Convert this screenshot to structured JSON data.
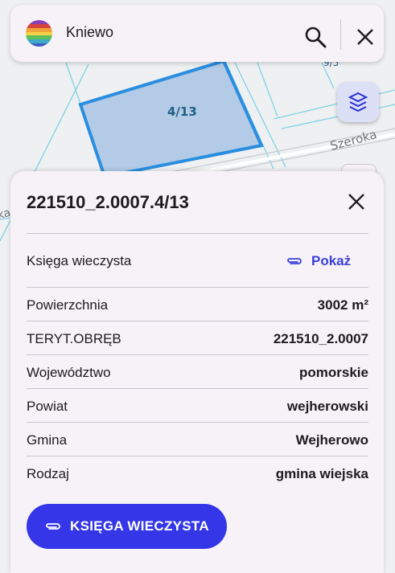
{
  "search": {
    "query": "Kniewo"
  },
  "map": {
    "road_label": "Szeroka",
    "parcel_label": "4/13",
    "partial_label_top": "9/5",
    "partial_label_left": "ka"
  },
  "sheet": {
    "title": "221510_2.0007.4/13",
    "kw_row": {
      "label": "Księga wieczysta",
      "link": "Pokaż"
    },
    "rows": [
      {
        "label": "Powierzchnia",
        "value": "3002 m²"
      },
      {
        "label": "TERYT.OBRĘB",
        "value": "221510_2.0007"
      },
      {
        "label": "Województwo",
        "value": "pomorskie"
      },
      {
        "label": "Powiat",
        "value": "wejherowski"
      },
      {
        "label": "Gmina",
        "value": "Wejherowo"
      },
      {
        "label": "Rodzaj",
        "value": "gmina wiejska"
      }
    ],
    "button_label": "KSIĘGA WIECZYSTA"
  },
  "icons": [
    "app-logo-icon",
    "search-icon",
    "close-icon",
    "layers-icon",
    "paperclip-icon"
  ],
  "colors": {
    "accent": "#3436e8",
    "parcel_fill": "#b3cbe6",
    "parcel_stroke": "#2a8ee0",
    "map_line": "#7fd3e4"
  }
}
